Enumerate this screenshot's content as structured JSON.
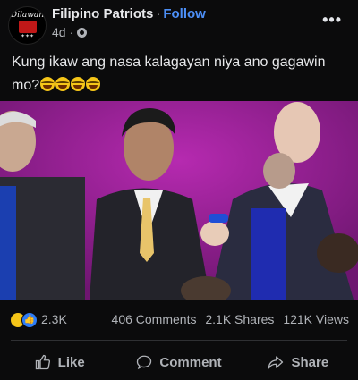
{
  "post": {
    "page_name": "Filipino Patriots",
    "separator": "·",
    "follow_label": "Follow",
    "time": "4d",
    "time_separator": "·",
    "audience_icon": "gear-icon",
    "more_icon": "ellipsis-icon",
    "caption_text": "Kung ikaw ang nasa kalagayan niya ano gagawin mo?"
  },
  "stats": {
    "reactions": "2.3K",
    "comments": "406 Comments",
    "shares": "2.1K Shares",
    "views": "121K Views"
  },
  "actions": {
    "like": "Like",
    "comment": "Comment",
    "share": "Share"
  },
  "colors": {
    "background": "#0b0b0c",
    "accent": "#4c8ef5",
    "muted": "#b0b3b8",
    "video_bg": "#8b1d86"
  }
}
